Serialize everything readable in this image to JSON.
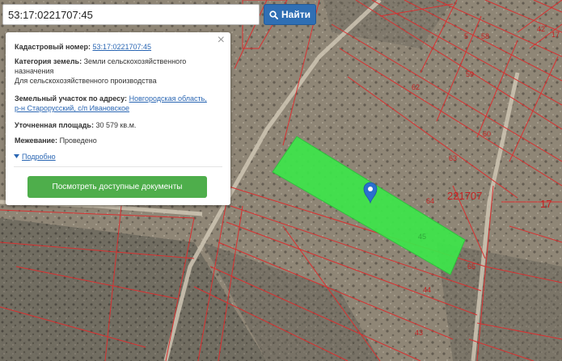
{
  "search": {
    "value": "53:17:0221707:45",
    "button_label": "Найти",
    "button_icon": "search-icon"
  },
  "info_panel": {
    "close_label": "×",
    "cadastral": {
      "label": "Кадастровый номер:",
      "value": "53:17:0221707:45"
    },
    "category": {
      "label": "Категория земель:",
      "value_line1": "Земли сельскохозяйственного",
      "value_line2": "назначения",
      "value_line3": "Для сельскохозяйственного производства"
    },
    "address": {
      "label": "Земельный участок по адресу:",
      "value_line1": "Новгородская область,",
      "value_line2": "р-н Старорусский, с/п Ивановское"
    },
    "area": {
      "label": "Уточненная площадь:",
      "value": "30 579 кв.м."
    },
    "survey": {
      "label": "Межевание:",
      "value": "Проведено"
    },
    "details_label": "Подробно",
    "documents_button": "Посмотреть доступные документы"
  },
  "map": {
    "parcel_numbers": [
      "58",
      "42",
      "5",
      "17",
      "59",
      "62",
      "60",
      "63",
      "64",
      "221707",
      "17",
      "45",
      "65",
      "44",
      "43"
    ],
    "colors": {
      "selected_parcel": "#3de64a",
      "parcel_border": "#d93030",
      "marker": "#2a6fd0",
      "link": "#2a66b3",
      "button_blue": "#2f6fb4",
      "button_green": "#4eae4b"
    }
  }
}
